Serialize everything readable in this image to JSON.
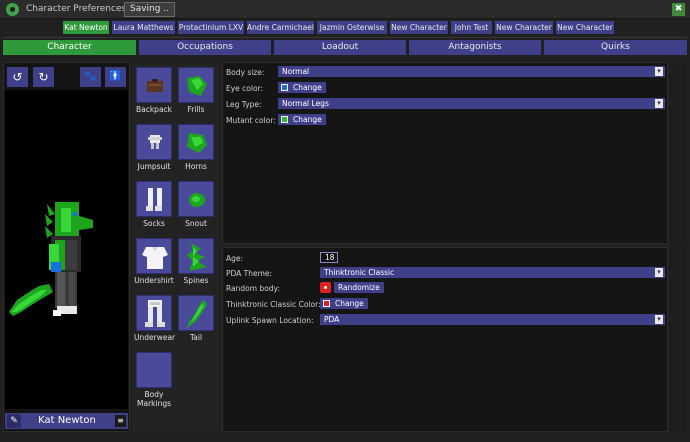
{
  "window": {
    "title": "Character Preferences",
    "saving_label": "Saving ..",
    "close_symbol": "✖"
  },
  "profiles": [
    "Kat Newton",
    "Laura Matthews",
    "Protactinium LXV",
    "Andre Carmichael",
    "Jazmin Osterwise",
    "New Character",
    "John Test",
    "New Character",
    "New Character"
  ],
  "main_tabs": [
    "Character",
    "Occupations",
    "Loadout",
    "Antagonists",
    "Quirks"
  ],
  "preview": {
    "rotate_left": "↺",
    "rotate_right": "↻",
    "paw": "🐾",
    "person": "🚹",
    "character_name": "Kat Newton",
    "edit_symbol": "✎",
    "menu_symbol": "≡"
  },
  "slots": {
    "backpack": "Backpack",
    "frills": "Frills",
    "jumpsuit": "Jumpsuit",
    "horns": "Horns",
    "socks": "Socks",
    "snout": "Snout",
    "undershirt": "Undershirt",
    "spines": "Spines",
    "underwear": "Underwear",
    "tail": "Tail",
    "body_markings": "Body Markings"
  },
  "features": {
    "body_size_label": "Body size:",
    "body_size_value": "Normal",
    "eye_color_label": "Eye color:",
    "eye_color_button": "Change",
    "eye_color_hex": "#1a6ee0",
    "leg_type_label": "Leg Type:",
    "leg_type_value": "Normal Legs",
    "mutant_color_label": "Mutant color:",
    "mutant_color_button": "Change",
    "mutant_color_hex": "#1ec81e"
  },
  "general": {
    "age_label": "Age:",
    "age_value": "18",
    "pda_theme_label": "PDA Theme:",
    "pda_theme_value": "Thinktronic Classic",
    "random_body_label": "Random body:",
    "randomize_button": "Randomize",
    "classic_color_label": "Thinktronic Classic Color:",
    "classic_color_button": "Change",
    "classic_color_hex": "#e02020",
    "uplink_label": "Uplink Spawn Location:",
    "uplink_value": "PDA"
  },
  "dropdown_arrow": "▾",
  "colors": {
    "accent_green": "#2f9a3c",
    "button_blue": "#40408a",
    "background": "#202020"
  }
}
